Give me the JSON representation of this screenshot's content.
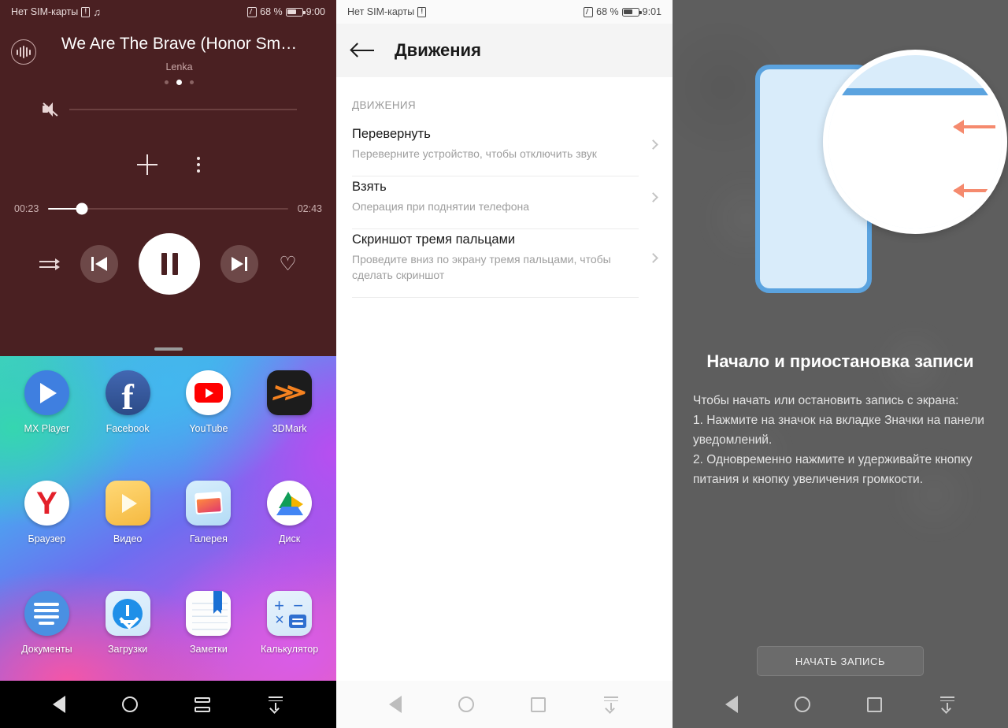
{
  "panel1": {
    "statusbar": {
      "carrier": "Нет SIM-карты",
      "sim_icon": "sim-missing-icon",
      "music_icon": "music-note-icon",
      "nfc_icon": "nfc-icon",
      "battery": "68 %",
      "time": "9:00"
    },
    "player": {
      "app_icon": "audio-waveform-icon",
      "title": "We Are The Brave (Honor Sm…",
      "artist": "Lenka",
      "page_dots": 3,
      "active_dot": 1,
      "mute_icon": "volume-mute-icon",
      "volume_value": 0,
      "add_icon": "plus-icon",
      "more_icon": "overflow-menu-icon",
      "elapsed": "00:23",
      "duration": "02:43",
      "progress_percent": 14,
      "shuffle_icon": "shuffle-icon",
      "previous_icon": "skip-previous-icon",
      "play_pause_icon": "pause-icon",
      "next_icon": "skip-next-icon",
      "favorite_icon": "heart-icon",
      "favorite_glyph": "♡",
      "accent_bg": "#4a2022"
    },
    "home": {
      "apps": [
        {
          "label": "MX Player",
          "icon": "mx-player-icon"
        },
        {
          "label": "Facebook",
          "icon": "facebook-icon",
          "glyph": "f"
        },
        {
          "label": "YouTube",
          "icon": "youtube-icon"
        },
        {
          "label": "3DMark",
          "icon": "3dmark-icon",
          "glyph": "≫"
        },
        {
          "label": "Браузер",
          "icon": "yandex-browser-icon",
          "glyph": "Y"
        },
        {
          "label": "Видео",
          "icon": "video-icon"
        },
        {
          "label": "Галерея",
          "icon": "gallery-icon"
        },
        {
          "label": "Диск",
          "icon": "google-drive-icon"
        },
        {
          "label": "Документы",
          "icon": "documents-icon"
        },
        {
          "label": "Загрузки",
          "icon": "downloads-icon"
        },
        {
          "label": "Заметки",
          "icon": "notes-icon"
        },
        {
          "label": "Калькулятор",
          "icon": "calculator-icon"
        }
      ]
    },
    "navbar": {
      "back": "back-icon",
      "home": "home-icon",
      "recents": "recents-icon",
      "notifications": "pull-down-notifications-icon"
    }
  },
  "panel2": {
    "statusbar": {
      "carrier": "Нет SIM-карты",
      "sim_icon": "sim-missing-icon",
      "nfc_icon": "nfc-icon",
      "battery": "68 %",
      "time": "9:01"
    },
    "header": {
      "back_icon": "back-arrow-icon",
      "title": "Движения"
    },
    "section_label": "ДВИЖЕНИЯ",
    "rows": [
      {
        "title": "Перевернуть",
        "subtitle": "Переверните устройство, чтобы отключить звук",
        "chevron": "chevron-right-icon"
      },
      {
        "title": "Взять",
        "subtitle": "Операция при поднятии телефона",
        "chevron": "chevron-right-icon"
      },
      {
        "title": "Скриншот тремя пальцами",
        "subtitle": "Проведите вниз по экрану тремя пальцами, чтобы сделать скриншот",
        "chevron": "chevron-right-icon"
      }
    ],
    "navbar": {
      "back": "back-icon",
      "home": "home-icon",
      "recents": "recents-icon",
      "notifications": "pull-down-notifications-icon"
    }
  },
  "panel3": {
    "illustration": {
      "phone_icon": "phone-outline-icon",
      "magnifier_icon": "magnifier-circle-icon",
      "power_button_icon": "power-button-icon",
      "volume_up_button_icon": "volume-up-button-icon",
      "arrow_icon": "arrow-left-icon",
      "phone_color": "#5ba3df",
      "arrow_color": "#f58a6e"
    },
    "title": "Начало и приостановка записи",
    "body_line1": "Чтобы начать или остановить запись с экрана:",
    "body_line2": "1. Нажмите на значок на вкладке Значки на панели уведомлений.",
    "body_line3": "2. Одновременно нажмите и удерживайте кнопку питания и кнопку увеличения громкости.",
    "button_label": "НАЧАТЬ ЗАПИСЬ",
    "navbar": {
      "back": "back-icon",
      "home": "home-icon",
      "recents": "recents-icon",
      "notifications": "pull-down-notifications-icon"
    }
  }
}
